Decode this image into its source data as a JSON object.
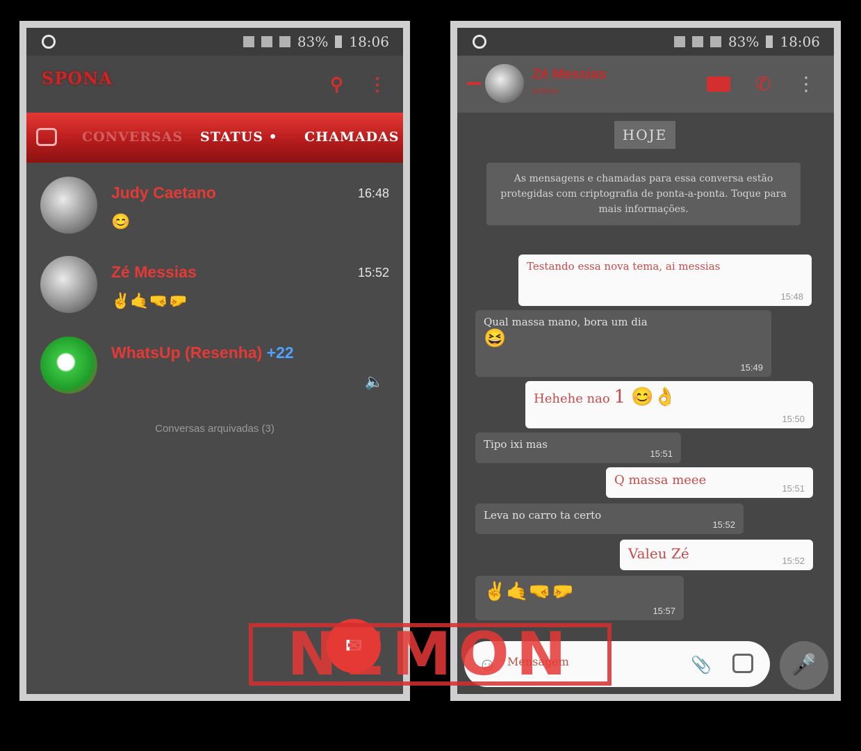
{
  "status": {
    "battery": "83%",
    "time": "18:06"
  },
  "left": {
    "logo": "SPONA",
    "tabs": {
      "chats": "CONVERSAS",
      "status": "STATUS •",
      "calls": "CHAMADAS"
    },
    "chats": [
      {
        "name": "Judy Caetano",
        "time": "16:48",
        "preview": "😊"
      },
      {
        "name": "Zé Messias",
        "time": "15:52",
        "preview": "✌️🤙🤜🤛"
      },
      {
        "name": "WhatsUp (Resenha)",
        "badge": "+22",
        "time": "",
        "preview": ""
      }
    ],
    "archived": "Conversas arquivadas (3)"
  },
  "right": {
    "contact_name": "Zé Messias",
    "contact_status": "online",
    "date_chip": "HOJE",
    "system_message": "As mensagens e chamadas para essa conversa estão protegidas com criptografia de ponta-a-ponta. Toque para mais informações.",
    "messages": [
      {
        "dir": "out",
        "text": "Testando essa nova tema, ai messias",
        "time": "15:48"
      },
      {
        "dir": "in",
        "text": "Qual massa mano, bora um dia",
        "emoji": "😆",
        "time": "15:49"
      },
      {
        "dir": "out",
        "text": "Hehehe nao ",
        "emoji": "1 😊👌",
        "time": "15:50"
      },
      {
        "dir": "in",
        "text": "Tipo ixi mas",
        "time": "15:51"
      },
      {
        "dir": "out",
        "text": "Q massa meee",
        "time": "15:51"
      },
      {
        "dir": "in",
        "text": "Leva no carro ta certo",
        "time": "15:52"
      },
      {
        "dir": "out",
        "text": "Valeu Zé",
        "time": "15:52"
      },
      {
        "dir": "in",
        "text": "",
        "emoji": "✌️🤙🤜🤛",
        "time": "15:57"
      }
    ],
    "input_placeholder": "Mensagem"
  },
  "watermark": "NEMON",
  "colors": {
    "accent": "#e53935",
    "screen": "#4a4a4a"
  }
}
